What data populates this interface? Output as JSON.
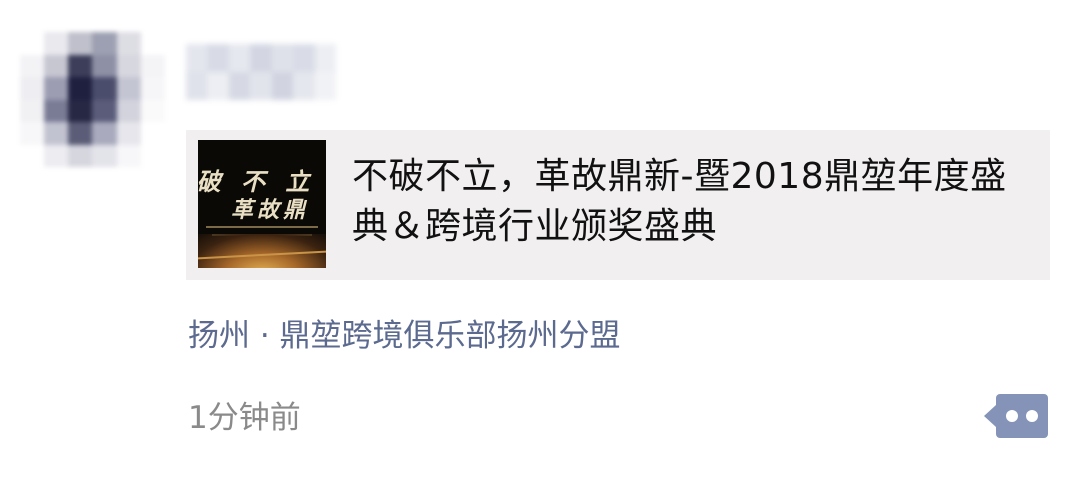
{
  "post": {
    "link_card": {
      "thumbnail": {
        "line1": "破 不 立",
        "line2": "革故鼎"
      },
      "title": "不破不立，革故鼎新-暨2018鼎堃年度盛典＆跨境行业颁奖盛典"
    },
    "location": "扬州 · 鼎堃跨境俱乐部扬州分盟",
    "timestamp": "1分钟前",
    "more_button": {
      "icon": "more-dots-icon"
    }
  },
  "colors": {
    "link_card_bg": "#f1eff0",
    "location_text": "#5b6a8e",
    "timestamp_text": "#8a8a8a",
    "more_button_bg": "#8593b8"
  }
}
